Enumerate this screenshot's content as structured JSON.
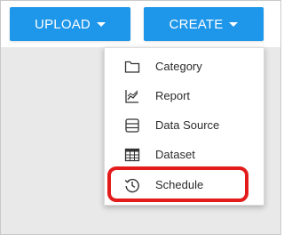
{
  "toolbar": {
    "upload_label": "UPLOAD",
    "create_label": "CREATE"
  },
  "menu": {
    "items": [
      {
        "label": "Category",
        "icon": "folder-icon"
      },
      {
        "label": "Report",
        "icon": "line-chart-icon"
      },
      {
        "label": "Data Source",
        "icon": "data-source-icon"
      },
      {
        "label": "Dataset",
        "icon": "table-icon"
      },
      {
        "label": "Schedule",
        "icon": "history-clock-icon"
      }
    ]
  },
  "colors": {
    "primary_button": "#1e96ea",
    "highlight": "#e41b1b"
  }
}
